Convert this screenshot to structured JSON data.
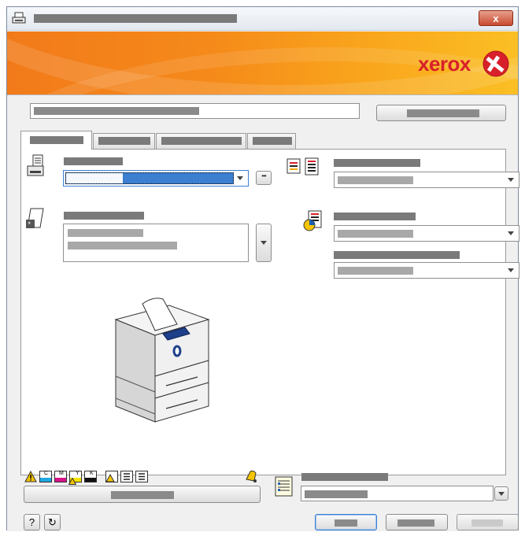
{
  "window": {
    "close_label": "x"
  },
  "banner": {
    "brand": "xerox"
  },
  "icons": {
    "title": "printer-icon",
    "printer_row": "printer-icon",
    "paper_row": "paper-icon",
    "sides_row": "document-lines-icon",
    "color_row": "color-document-icon",
    "warning": "warning-icon",
    "bell": "bell-icon",
    "summary": "list-icon",
    "help": "help-icon",
    "reset": "reset-icon",
    "more": "ellipsis-icon"
  },
  "help_label": "?",
  "reset_label": "↻",
  "more_label": "•••",
  "toner": [
    {
      "label": "C",
      "color": "#1fa8e0"
    },
    {
      "label": "M",
      "color": "#d7148a"
    },
    {
      "label": "Y",
      "color": "#f5e400"
    },
    {
      "label": "K",
      "color": "#111111"
    }
  ],
  "colors": {
    "accent": "#3c7fd0",
    "banner_start": "#f27a1a",
    "banner_end": "#fbbf24",
    "brand_logo": "#d8202a"
  }
}
